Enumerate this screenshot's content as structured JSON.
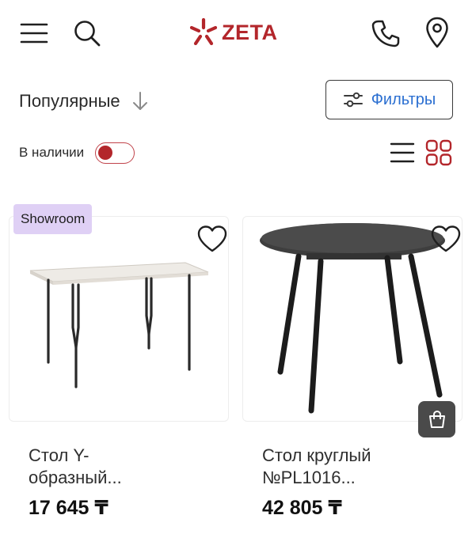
{
  "header": {
    "logo_text": "ZETA",
    "brand_color": "#b3262b",
    "icons": [
      "menu-icon",
      "search-icon",
      "phone-icon",
      "location-pin-icon"
    ]
  },
  "toolbar": {
    "sort_label": "Популярные",
    "filter_label": "Фильтры",
    "in_stock_label": "В наличии",
    "in_stock_enabled": false
  },
  "products": [
    {
      "badge": "Showroom",
      "name_line1": "Стол Y-",
      "name_line2": "образный...",
      "price": "17 645 ₸"
    },
    {
      "badge": "",
      "name_line1": "Стол круглый",
      "name_line2": "№PL1016...",
      "price": "42 805 ₸"
    }
  ],
  "colors": {
    "accent_blue": "#2b6fd1",
    "badge_bg": "#dfd0f5",
    "cart_button_bg": "#4a4a4a"
  }
}
